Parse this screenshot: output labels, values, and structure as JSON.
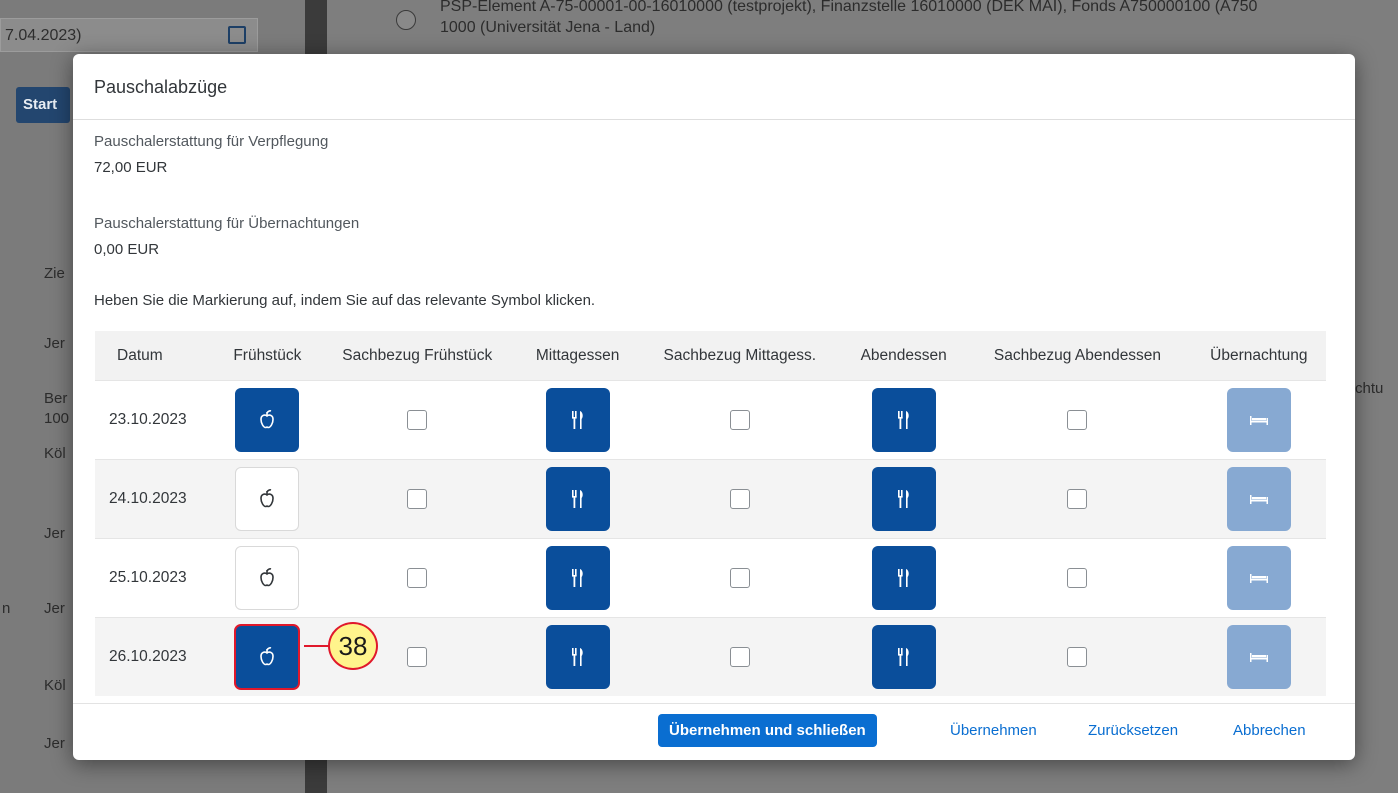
{
  "background": {
    "date_field": "7.04.2023)",
    "start_button": "Start",
    "top_text_line1": "PSP-Element A-75-00001-00-16010000 (testprojekt), Finanzstelle 16010000 (DEK MAI), Fonds A750000100 (A750",
    "top_text_line2": "1000 (Universität Jena - Land)",
    "left_rows": [
      "Zie",
      "Jer",
      "Ber",
      "100",
      "Köl",
      "Jer",
      "Jer",
      "Köl",
      "Jer"
    ],
    "left_edge_n": "n",
    "right_cut": "chtu"
  },
  "dialog": {
    "title": "Pauschalabzüge",
    "meals_label": "Pauschalerstattung für Verpflegung",
    "meals_value": "72,00  EUR",
    "lodging_label": "Pauschalerstattung für Übernachtungen",
    "lodging_value": "0,00  EUR",
    "hint": "Heben Sie die Markierung auf, indem Sie auf das relevante Symbol klicken.",
    "columns": [
      "Datum",
      "Frühstück",
      "Sachbezug Frühstück",
      "Mittagessen",
      "Sachbezug Mittagess.",
      "Abendessen",
      "Sachbezug Abendessen",
      "Übernachtung"
    ],
    "rows": [
      {
        "date": "23.10.2023",
        "breakfast": true
      },
      {
        "date": "24.10.2023",
        "breakfast": false
      },
      {
        "date": "25.10.2023",
        "breakfast": false
      },
      {
        "date": "26.10.2023",
        "breakfast": true
      }
    ],
    "icons": {
      "breakfast": "apple-icon",
      "lunch": "cutlery-icon",
      "dinner": "cutlery-icon",
      "overnight": "bed-icon"
    },
    "buttons": {
      "apply_close": "Übernehmen und schließen",
      "apply": "Übernehmen",
      "reset": "Zurücksetzen",
      "cancel": "Abbrechen"
    }
  },
  "callout": {
    "number": "38"
  },
  "colors": {
    "accent": "#0a6ed1",
    "active": "#0a4e9b",
    "faded": "#87a9d2",
    "marker": "#e0182b"
  }
}
